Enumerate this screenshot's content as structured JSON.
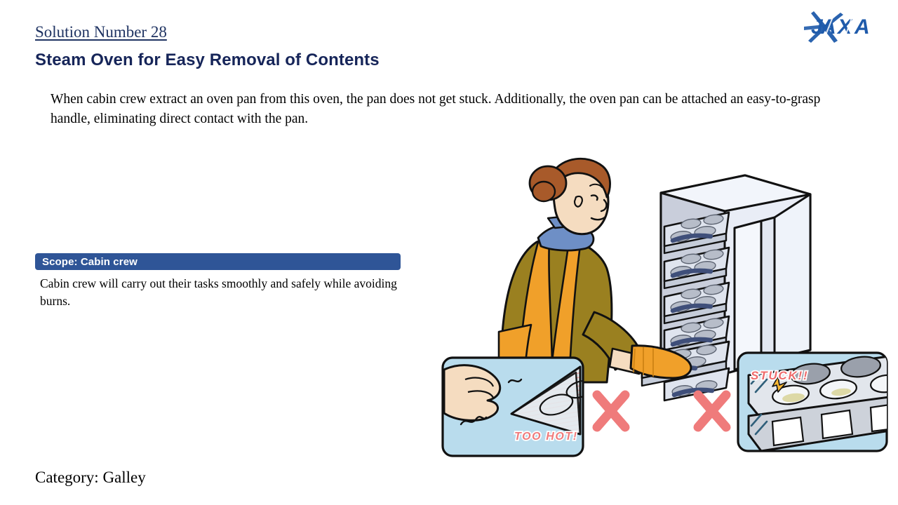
{
  "header": {
    "solution_number": "Solution Number 28",
    "title": "Steam Oven for Easy Removal of Contents",
    "logo_text": "JAXA",
    "logo_name": "jaxa-logo"
  },
  "description": {
    "text": "When cabin crew extract an oven pan from this oven, the pan does not get stuck. Additionally, the oven pan can be attached an easy-to-grasp handle, eliminating direct contact with the pan."
  },
  "scope": {
    "bar_label": "Scope: Cabin crew",
    "body": "Cabin crew will carry out their tasks smoothly and safely while avoiding burns."
  },
  "footer": {
    "category": "Category: Galley"
  },
  "illustration": {
    "left_panel_caption": "TOO HOT!",
    "right_panel_caption": "STUCK!!",
    "cross_mark_1": "✕",
    "cross_mark_2": "✕",
    "alt_description": "Cabin crew member in olive jacket and orange apron pulling an oven pan from a multi-shelf steam oven; two inset panels show a hand recoiling from a hot pan and a pan tray stuck in the rack, each marked with a red cross."
  },
  "colors": {
    "title_navy": "#162559",
    "solution_navy": "#1f3362",
    "scope_bar_blue": "#2f5597",
    "logo_blue": "#1f5bab",
    "cross_red": "#ef7b7b",
    "panel_blue": "#b9dced",
    "apron_orange": "#f0a02a",
    "jacket_olive": "#9a8020",
    "hair_brown": "#a85a2a",
    "scarf_blue": "#6e8fc6",
    "skin": "#f5dcc0",
    "oven_grey": "#dfe5ef",
    "handle_navy": "#3f4f7a"
  }
}
